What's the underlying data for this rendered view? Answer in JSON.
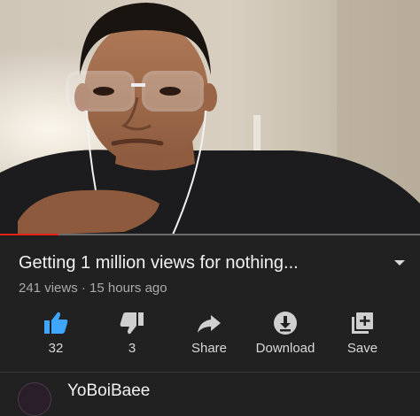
{
  "video": {
    "title": "Getting 1 million views for nothing...",
    "views": "241 views",
    "separator": "·",
    "age": "15 hours ago",
    "progress_fraction": 0.14
  },
  "actions": [
    {
      "icon": "thumbs-up-icon",
      "label": "32",
      "active": true
    },
    {
      "icon": "thumbs-down-icon",
      "label": "3",
      "active": false
    },
    {
      "icon": "share-icon",
      "label": "Share",
      "active": false
    },
    {
      "icon": "download-icon",
      "label": "Download",
      "active": false
    },
    {
      "icon": "playlist-add-icon",
      "label": "Save",
      "active": false
    }
  ],
  "channel": {
    "name": "YoBoiBaee"
  },
  "colors": {
    "background": "#212121",
    "accent_like": "#3ea6ff",
    "progress_played": "#e62117",
    "icon_grey": "#cfcfcf",
    "meta_text": "#aaaaaa"
  }
}
